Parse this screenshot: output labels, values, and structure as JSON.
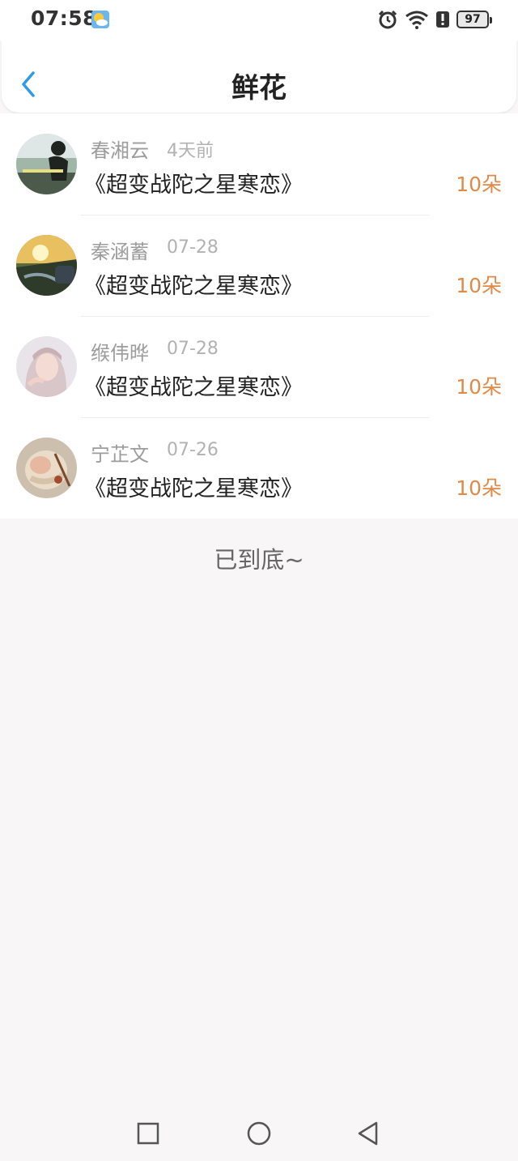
{
  "status_bar": {
    "time": "07:58",
    "battery": "97",
    "icons": [
      "weather-icon",
      "alarm-icon",
      "wifi-icon",
      "alert-icon",
      "battery-icon"
    ]
  },
  "header": {
    "title": "鲜花",
    "back_icon": "chevron-left-icon"
  },
  "flowers": [
    {
      "name": "春湘云",
      "time": "4天前",
      "book": "《超变战陀之星寒恋》",
      "amount": "10朵"
    },
    {
      "name": "秦涵蓄",
      "time": "07-28",
      "book": "《超变战陀之星寒恋》",
      "amount": "10朵"
    },
    {
      "name": "缑伟晔",
      "time": "07-28",
      "book": "《超变战陀之星寒恋》",
      "amount": "10朵"
    },
    {
      "name": "宁芷文",
      "time": "07-26",
      "book": "《超变战陀之星寒恋》",
      "amount": "10朵"
    }
  ],
  "end_text": "已到底~",
  "nav_bar": {
    "icons": [
      "recent-apps-icon",
      "home-icon",
      "back-icon"
    ]
  },
  "colors": {
    "accent": "#2f9be8",
    "amount": "#e08a47",
    "background": "#f8f6f7"
  }
}
